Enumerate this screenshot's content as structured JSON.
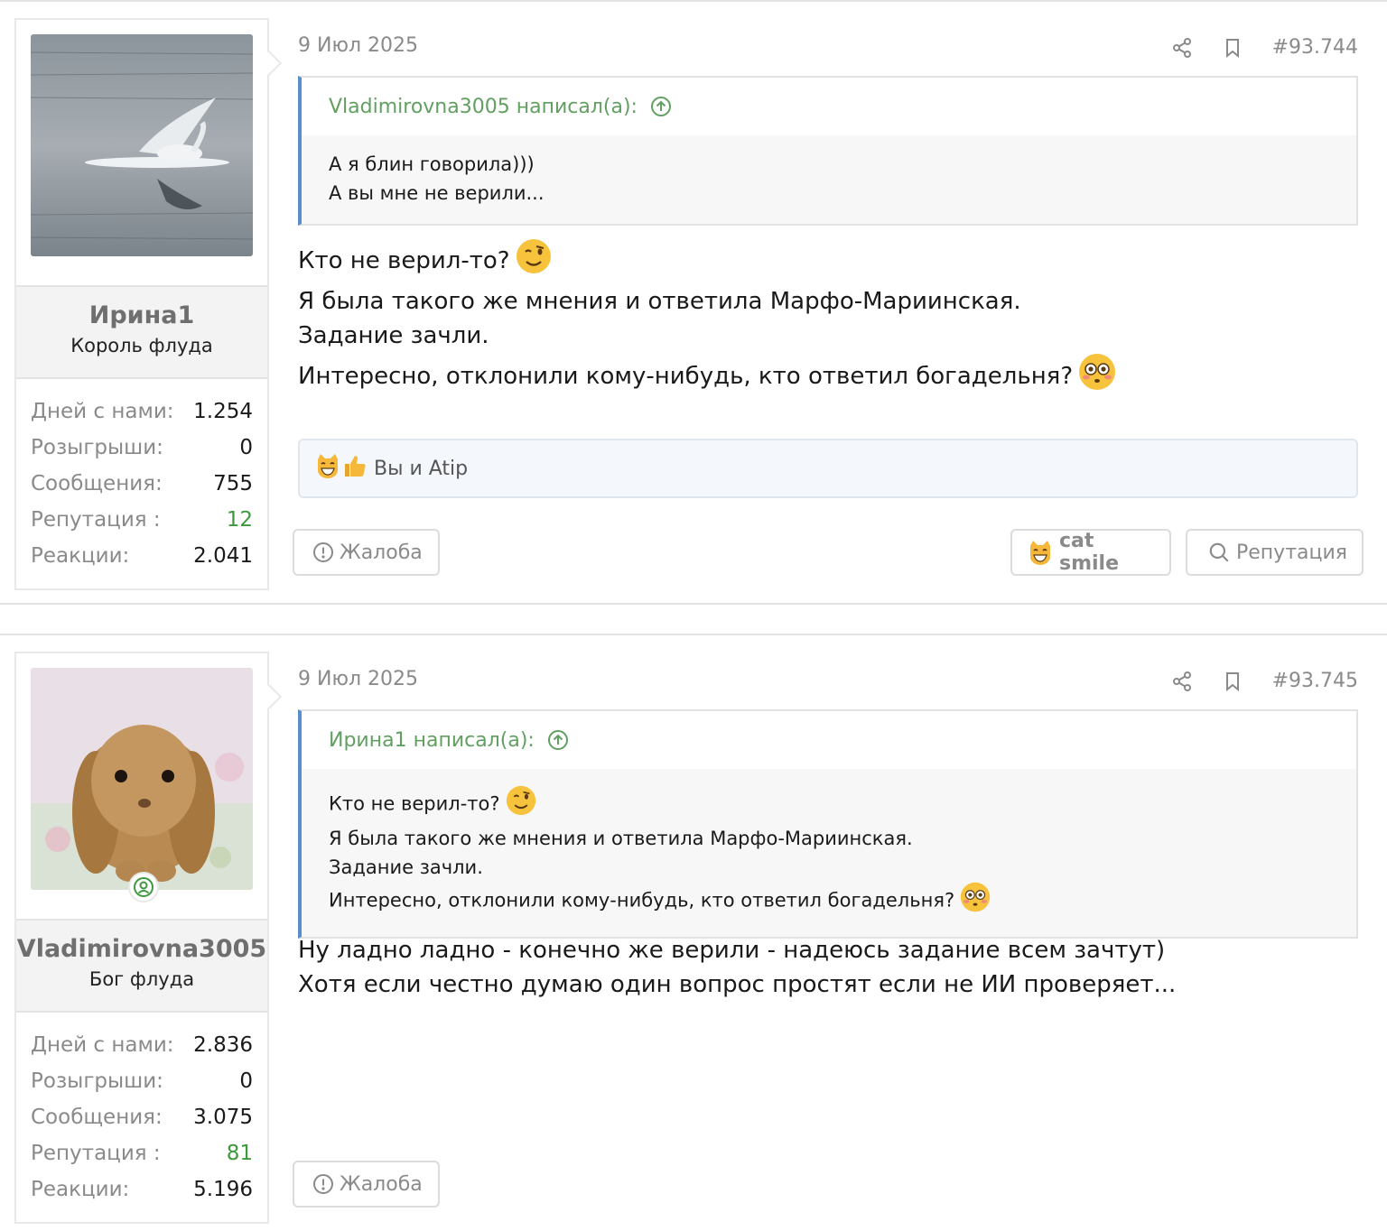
{
  "posts": [
    {
      "username": "Ирина1",
      "usertitle": "Король флуда",
      "stats": [
        {
          "label": "Дней с нами:",
          "value": "1.254"
        },
        {
          "label": "Розыгрыши:",
          "value": "0"
        },
        {
          "label": "Сообщения:",
          "value": "755"
        },
        {
          "label": "Репутация :",
          "value": "12"
        },
        {
          "label": "Реакции:",
          "value": "2.041"
        }
      ],
      "date": "9 Июл 2025",
      "post_number": "#93.744",
      "quote": {
        "author_line": "Vladimirovna3005 написал(а):",
        "lines": [
          "А я блин говорила)))",
          "А вы мне не верили..."
        ]
      },
      "message_lines": [
        "Кто не верил-то?",
        "Я была такого же мнения и ответила Марфо-Мариинская.",
        "Задание зачли.",
        "Интересно, отклонили кому-нибудь, кто ответил богадельня?"
      ],
      "reactions_text": "Вы и Atip",
      "buttons": {
        "report": "Жалоба",
        "cat_smile": "cat smile",
        "reputation": "Репутация"
      }
    },
    {
      "username": "Vladimirovna3005",
      "usertitle": "Бог флуда",
      "stats": [
        {
          "label": "Дней с нами:",
          "value": "2.836"
        },
        {
          "label": "Розыгрыши:",
          "value": "0"
        },
        {
          "label": "Сообщения:",
          "value": "3.075"
        },
        {
          "label": "Репутация :",
          "value": "81"
        },
        {
          "label": "Реакции:",
          "value": "5.196"
        }
      ],
      "date": "9 Июл 2025",
      "post_number": "#93.745",
      "quote": {
        "author_line": "Ирина1 написал(а):",
        "lines": [
          "Кто не верил-то?",
          "Я была такого же мнения и ответила Марфо-Мариинская.",
          "Задание зачли.",
          "Интересно, отклонили кому-нибудь, кто ответил богадельня?"
        ]
      },
      "message_lines": [
        "Ну ладно ладно - конечно же верили - надеюсь задание всем зачтут)",
        "Хотя если честно думаю один вопрос простят если не ИИ проверяет..."
      ],
      "buttons": {
        "report": "Жалоба"
      }
    }
  ],
  "icons": {
    "share": "share-icon",
    "bookmark": "bookmark-icon",
    "quote_link": "arrow-up-circle-icon",
    "report": "exclamation-circle-icon",
    "reputation": "search-icon",
    "online": "person-circle-icon",
    "wink": "winking-face-emoji",
    "flushed": "flushed-face-emoji",
    "cat": "grinning-cat-emoji",
    "thumbs": "thumbs-up-emoji"
  },
  "colors": {
    "quote_author": "#62a062",
    "quote_border": "#5a8ec9",
    "reputation_value": "#3c9a3c",
    "muted_text": "#8a8a8a"
  }
}
